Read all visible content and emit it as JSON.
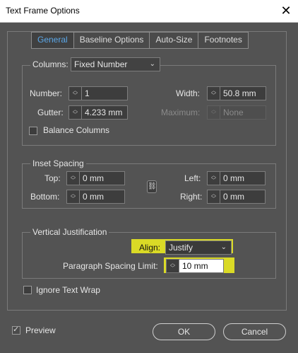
{
  "window": {
    "title": "Text Frame Options"
  },
  "tabs": [
    "General",
    "Baseline Options",
    "Auto-Size",
    "Footnotes"
  ],
  "columns": {
    "legend": "Columns:",
    "type_value": "Fixed Number",
    "number_label": "Number:",
    "number_value": "1",
    "width_label": "Width:",
    "width_value": "50.8 mm",
    "gutter_label": "Gutter:",
    "gutter_value": "4.233 mm",
    "maximum_label": "Maximum:",
    "maximum_value": "None",
    "balance_label": "Balance Columns"
  },
  "inset": {
    "legend": "Inset Spacing",
    "top_label": "Top:",
    "top_value": "0 mm",
    "bottom_label": "Bottom:",
    "bottom_value": "0 mm",
    "left_label": "Left:",
    "left_value": "0 mm",
    "right_label": "Right:",
    "right_value": "0 mm",
    "link_icon": "chain-link-icon"
  },
  "vertical": {
    "legend": "Vertical Justification",
    "align_label": "Align:",
    "align_value": "Justify",
    "psl_label": "Paragraph Spacing Limit:",
    "psl_value": "10 mm"
  },
  "ignore_wrap_label": "Ignore Text Wrap",
  "preview_label": "Preview",
  "ok_label": "OK",
  "cancel_label": "Cancel",
  "colors": {
    "background": "#535353",
    "active_tab": "#5ba7e8",
    "highlight": "#f2f21e"
  }
}
